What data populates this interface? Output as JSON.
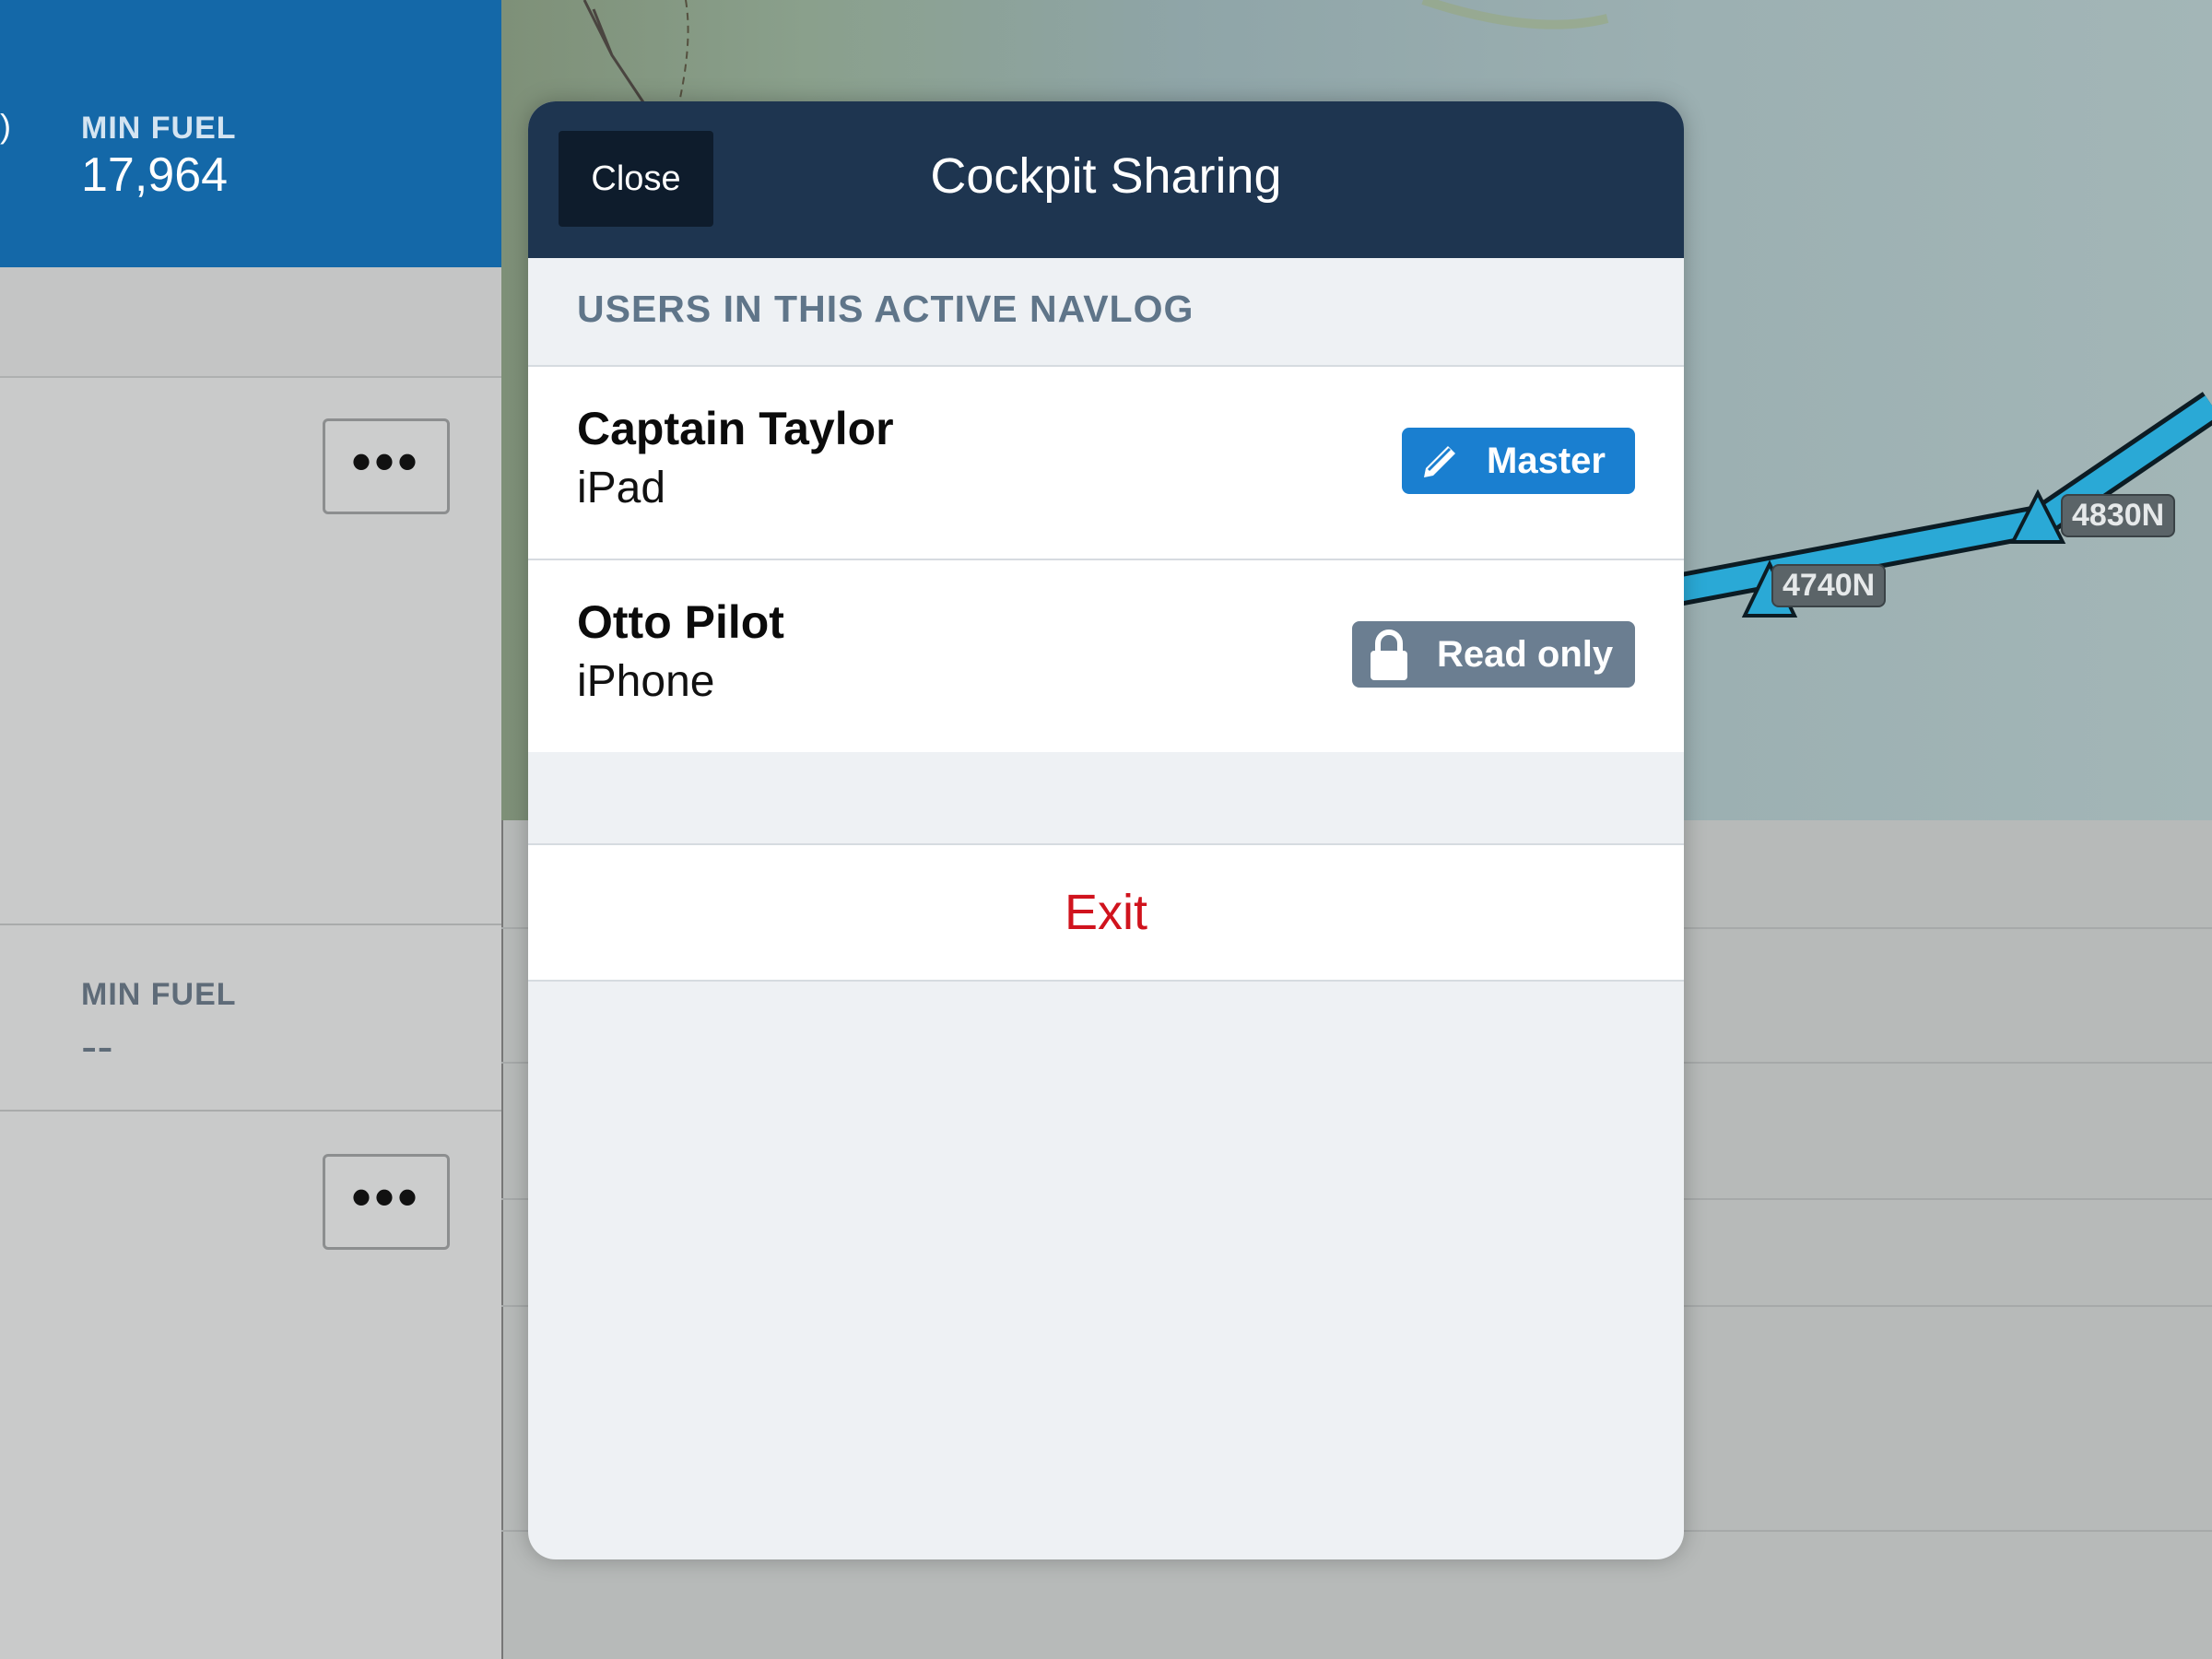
{
  "left_panel": {
    "block1": {
      "paren": ")",
      "label": "MIN FUEL",
      "value": "17,964"
    },
    "block2": {
      "label": "MIN FUEL",
      "value": "--"
    },
    "more_button_label": "•••"
  },
  "map": {
    "waypoints": [
      "4740N",
      "4830N"
    ],
    "route_color": "#2aa9d6"
  },
  "modal": {
    "close_label": "Close",
    "title": "Cockpit Sharing",
    "section_header": "USERS IN THIS ACTIVE NAVLOG",
    "users": [
      {
        "name": "Captain Taylor",
        "device": "iPad",
        "role": "Master",
        "role_icon": "pencil-icon",
        "role_color": "#1a7fd0"
      },
      {
        "name": "Otto Pilot",
        "device": "iPhone",
        "role": "Read only",
        "role_icon": "lock-icon",
        "role_color": "#6b7e91"
      }
    ],
    "exit_label": "Exit",
    "exit_color": "#d0131d"
  }
}
